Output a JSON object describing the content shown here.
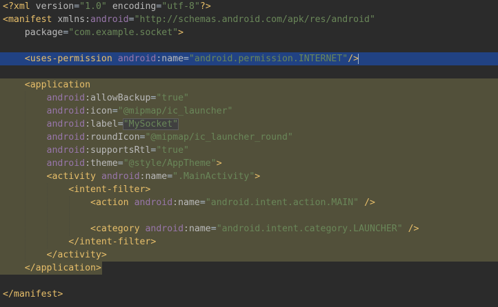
{
  "editor": {
    "language": "xml",
    "lines": [
      {
        "tokens": [
          [
            "decl",
            "<?xml "
          ],
          [
            "attr",
            "version"
          ],
          [
            "eq",
            "="
          ],
          [
            "val",
            "\"1.0\""
          ],
          [
            "punct",
            " "
          ],
          [
            "attr",
            "encoding"
          ],
          [
            "eq",
            "="
          ],
          [
            "val",
            "\"utf-8\""
          ],
          [
            "decl",
            "?>"
          ]
        ]
      },
      {
        "tokens": [
          [
            "tag",
            "<manifest "
          ],
          [
            "attr",
            "xmlns:"
          ],
          [
            "ns",
            "android"
          ],
          [
            "eq",
            "="
          ],
          [
            "val",
            "\"http://schemas.android.com/apk/res/android\""
          ]
        ]
      },
      {
        "tokens": [
          [
            "punct",
            "    "
          ],
          [
            "attr",
            "package"
          ],
          [
            "eq",
            "="
          ],
          [
            "val",
            "\"com.example.socket\""
          ],
          [
            "tag",
            ">"
          ]
        ]
      },
      {
        "tokens": []
      },
      {
        "hl": "blue",
        "tokens": [
          [
            "punct",
            "    "
          ],
          [
            "tag",
            "<uses-permission "
          ],
          [
            "ns",
            "android"
          ],
          [
            "attr",
            ":name"
          ],
          [
            "eq",
            "="
          ],
          [
            "val",
            "\"android.permission.INTERNET\""
          ],
          [
            "tag",
            "/>"
          ]
        ]
      },
      {
        "tokens": []
      },
      {
        "hl": "olive",
        "tokens": [
          [
            "punct",
            "    "
          ],
          [
            "tag",
            "<application"
          ]
        ]
      },
      {
        "hl": "olive",
        "tokens": [
          [
            "punct",
            "        "
          ],
          [
            "ns",
            "android"
          ],
          [
            "attr",
            ":allowBackup"
          ],
          [
            "eq",
            "="
          ],
          [
            "val",
            "\"true\""
          ]
        ]
      },
      {
        "hl": "olive",
        "tokens": [
          [
            "punct",
            "        "
          ],
          [
            "ns",
            "android"
          ],
          [
            "attr",
            ":icon"
          ],
          [
            "eq",
            "="
          ],
          [
            "val",
            "\"@mipmap/ic_launcher\""
          ]
        ]
      },
      {
        "hl": "olive",
        "tokens": [
          [
            "punct",
            "        "
          ],
          [
            "ns",
            "android"
          ],
          [
            "attr",
            ":label"
          ],
          [
            "eq",
            "="
          ],
          [
            "val",
            "\"MySocket\""
          ]
        ]
      },
      {
        "hl": "olive",
        "tokens": [
          [
            "punct",
            "        "
          ],
          [
            "ns",
            "android"
          ],
          [
            "attr",
            ":roundIcon"
          ],
          [
            "eq",
            "="
          ],
          [
            "val",
            "\"@mipmap/ic_launcher_round\""
          ]
        ]
      },
      {
        "hl": "olive",
        "tokens": [
          [
            "punct",
            "        "
          ],
          [
            "ns",
            "android"
          ],
          [
            "attr",
            ":supportsRtl"
          ],
          [
            "eq",
            "="
          ],
          [
            "val",
            "\"true\""
          ]
        ]
      },
      {
        "hl": "olive",
        "tokens": [
          [
            "punct",
            "        "
          ],
          [
            "ns",
            "android"
          ],
          [
            "attr",
            ":theme"
          ],
          [
            "eq",
            "="
          ],
          [
            "val",
            "\"@style/AppTheme\""
          ],
          [
            "tag",
            ">"
          ]
        ]
      },
      {
        "hl": "olive",
        "tokens": [
          [
            "punct",
            "        "
          ],
          [
            "tag",
            "<activity "
          ],
          [
            "ns",
            "android"
          ],
          [
            "attr",
            ":name"
          ],
          [
            "eq",
            "="
          ],
          [
            "val",
            "\".MainActivity\""
          ],
          [
            "tag",
            ">"
          ]
        ]
      },
      {
        "hl": "olive",
        "tokens": [
          [
            "punct",
            "            "
          ],
          [
            "tag",
            "<intent-filter>"
          ]
        ]
      },
      {
        "hl": "olive",
        "tokens": [
          [
            "punct",
            "                "
          ],
          [
            "tag",
            "<action "
          ],
          [
            "ns",
            "android"
          ],
          [
            "attr",
            ":name"
          ],
          [
            "eq",
            "="
          ],
          [
            "val",
            "\"android.intent.action.MAIN\""
          ],
          [
            "tag",
            " />"
          ]
        ]
      },
      {
        "hl": "olive",
        "tokens": []
      },
      {
        "hl": "olive",
        "tokens": [
          [
            "punct",
            "                "
          ],
          [
            "tag",
            "<category "
          ],
          [
            "ns",
            "android"
          ],
          [
            "attr",
            ":name"
          ],
          [
            "eq",
            "="
          ],
          [
            "val",
            "\"android.intent.category.LAUNCHER\""
          ],
          [
            "tag",
            " />"
          ]
        ]
      },
      {
        "hl": "olive",
        "tokens": [
          [
            "punct",
            "            "
          ],
          [
            "tag",
            "</intent-filter>"
          ]
        ]
      },
      {
        "hl": "olive",
        "tokens": [
          [
            "punct",
            "        "
          ],
          [
            "tag",
            "</activity>"
          ]
        ]
      },
      {
        "hl": "olive-part",
        "tokens": [
          [
            "punct",
            "    "
          ],
          [
            "tag",
            "</application>"
          ]
        ]
      },
      {
        "tokens": []
      },
      {
        "tokens": [
          [
            "tag",
            "</manifest>"
          ]
        ]
      }
    ]
  },
  "colors": {
    "background": "#2b2b2b",
    "selection_blue": "#214283",
    "selection_olive": "#52503a",
    "tag": "#e8bf6a",
    "namespace": "#9876aa",
    "string": "#6a8759",
    "text": "#a9b7c6"
  }
}
